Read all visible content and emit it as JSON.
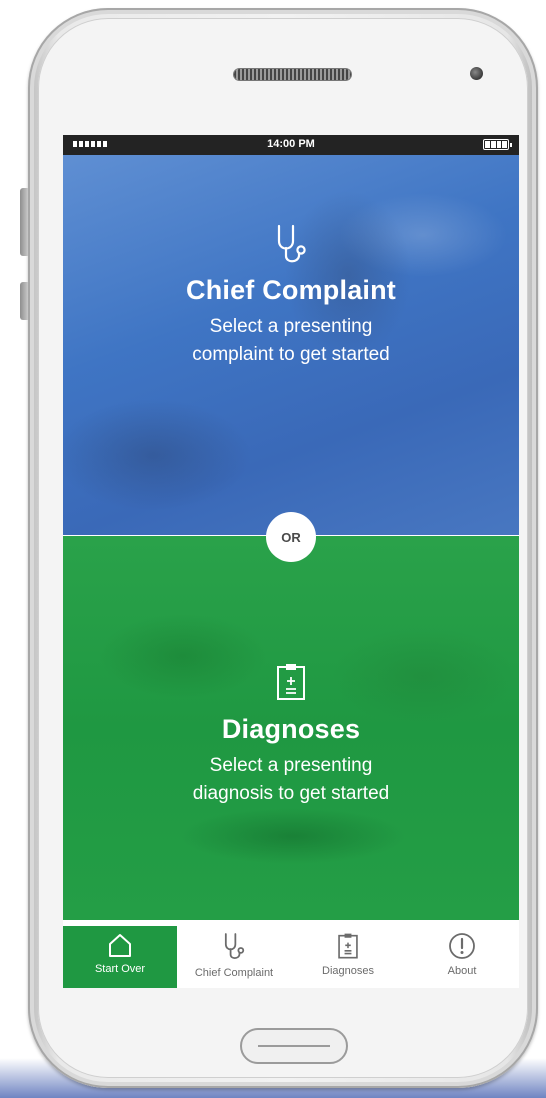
{
  "status_bar": {
    "time": "14:00 PM"
  },
  "chief_complaint": {
    "title": "Chief Complaint",
    "subtitle_line1": "Select a presenting",
    "subtitle_line2": "complaint to get started"
  },
  "separator": {
    "label": "OR"
  },
  "diagnoses": {
    "title": "Diagnoses",
    "subtitle_line1": "Select a presenting",
    "subtitle_line2": "diagnosis to get started"
  },
  "tabbar": {
    "items": [
      {
        "label": "Start Over",
        "icon": "home-icon",
        "active": true
      },
      {
        "label": "Chief Complaint",
        "icon": "stethoscope-icon",
        "active": false
      },
      {
        "label": "Diagnoses",
        "icon": "clipboard-icon",
        "active": false
      },
      {
        "label": "About",
        "icon": "info-icon",
        "active": false
      }
    ]
  },
  "colors": {
    "complaint_blue": "#3f75c4",
    "diagnoses_green": "#1f9842",
    "active_tab_green": "#1f9842"
  }
}
